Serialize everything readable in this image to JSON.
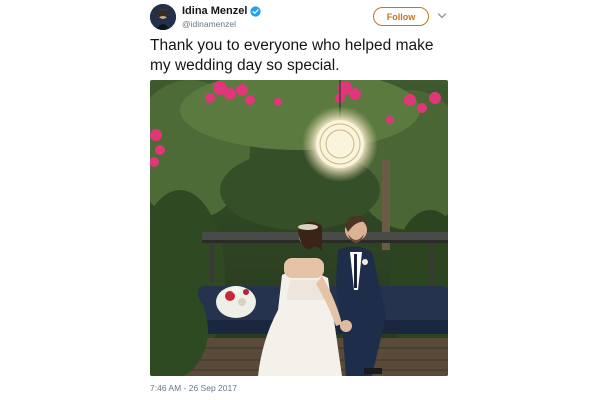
{
  "tweet": {
    "author": {
      "display_name": "Idina Menzel",
      "handle": "@idinamenzel",
      "verified_icon": "verified-badge-icon"
    },
    "follow_label": "Follow",
    "menu_icon": "chevron-down-icon",
    "text": "Thank you to everyone who helped make my wedding day so special.",
    "timestamp": "7:46 AM - 26 Sep 2017"
  },
  "colors": {
    "follow_accent": "#c47420",
    "verified_blue": "#1da1f2",
    "secondary_text": "#657786",
    "primary_text": "#14171a"
  }
}
